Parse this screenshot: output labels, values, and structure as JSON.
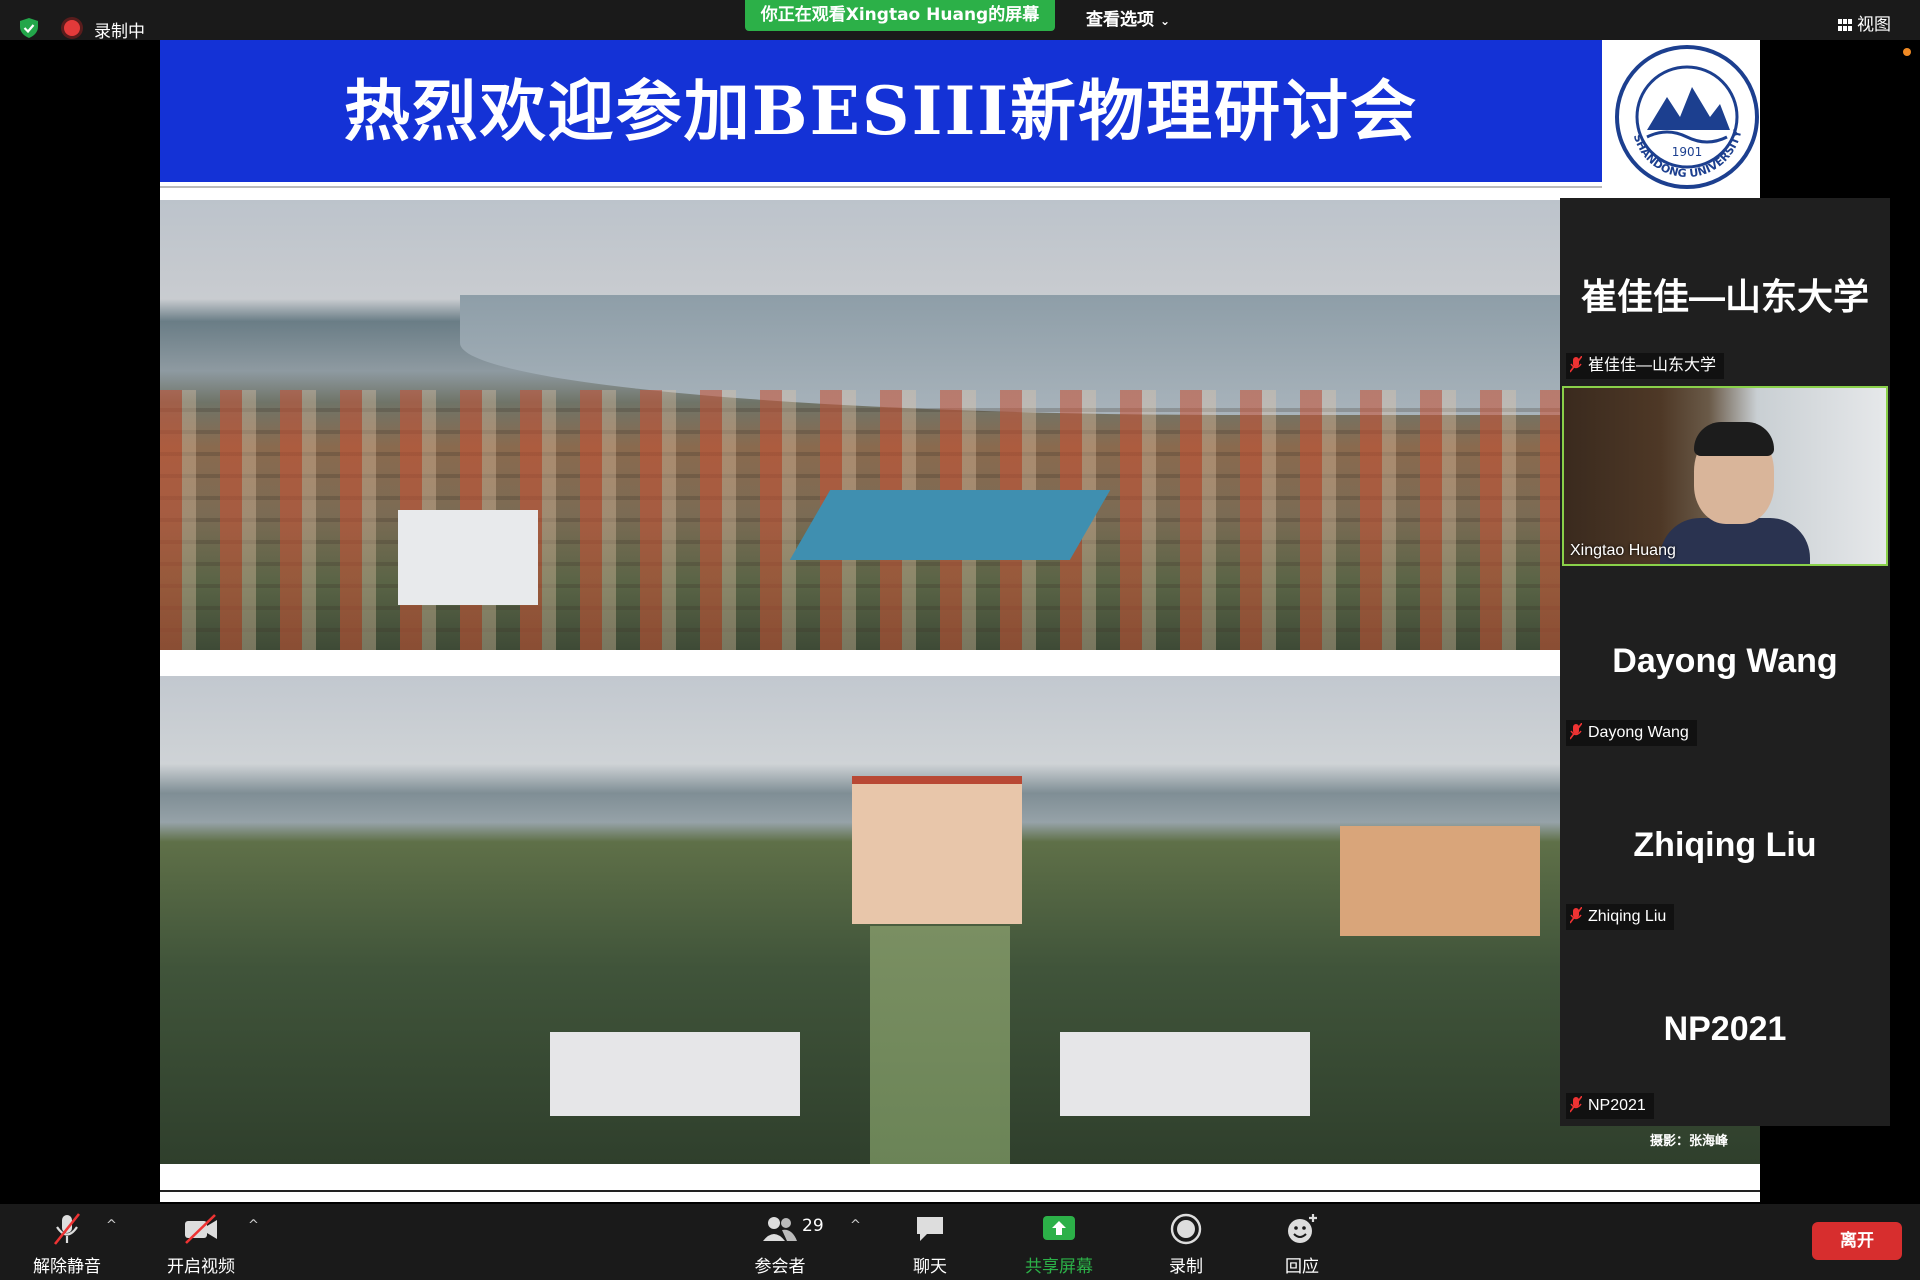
{
  "topbar": {
    "recording_label": "录制中",
    "share_banner": "你正在观看Xingtao Huang的屏幕",
    "view_options": "查看选项",
    "view_button": "视图"
  },
  "slide": {
    "title": "热烈欢迎参加BESIII新物理研讨会",
    "logo": {
      "year": "1901",
      "text": "SHANDONG UNIVERSITY"
    },
    "photo_credit": "摄影：张海峰"
  },
  "participants": [
    {
      "display": "崔佳佳—山东大学",
      "label": "崔佳佳—山东大学",
      "muted": true,
      "video": false
    },
    {
      "display": "",
      "label": "Xingtao Huang",
      "muted": false,
      "video": true,
      "speaking": true
    },
    {
      "display": "Dayong Wang",
      "label": "Dayong Wang",
      "muted": true,
      "video": false
    },
    {
      "display": "Zhiqing Liu",
      "label": "Zhiqing Liu",
      "muted": true,
      "video": false
    },
    {
      "display": "NP2021",
      "label": "NP2021",
      "muted": true,
      "video": false
    }
  ],
  "toolbar": {
    "unmute": "解除静音",
    "start_video": "开启视频",
    "participants": "参会者",
    "participant_count": "29",
    "chat": "聊天",
    "share_screen": "共享屏幕",
    "record": "录制",
    "reactions": "回应",
    "leave": "离开"
  },
  "colors": {
    "accent_green": "#2cb048",
    "title_blue": "#1432d6",
    "leave_red": "#d72e2e",
    "speaker_border": "#8ad14a"
  }
}
